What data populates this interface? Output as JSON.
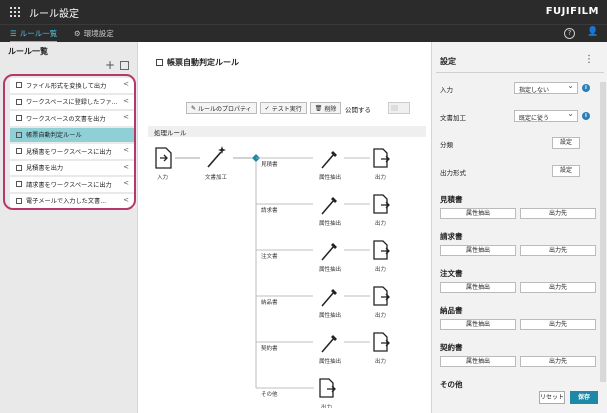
{
  "window": {
    "title": "ルール設定",
    "brand": "FUJIFILM"
  },
  "tabs": [
    {
      "label": "ルール一覧"
    },
    {
      "label": "環境設定"
    }
  ],
  "sidebar": {
    "title": "ルール一覧",
    "add_glyph": "+",
    "items": [
      {
        "label": "ファイル形式を変換して出力"
      },
      {
        "label": "ワークスペースに登録したファ..."
      },
      {
        "label": "ワークスペースの文書を出力"
      },
      {
        "label": "帳票自動判定ルール"
      },
      {
        "label": "見積書をワークスペースに出力"
      },
      {
        "label": "見積書を出力"
      },
      {
        "label": "請求書をワークスペースに出力"
      },
      {
        "label": "電子メールで入力した文書..."
      }
    ],
    "selected_index": 3
  },
  "main": {
    "rule_title": "帳票自動判定ルール",
    "toolbar": {
      "properties": "ルールのプロパティ",
      "test": "テスト実行",
      "delete": "削除",
      "publish": "公開する"
    },
    "section": "処理ルール",
    "flow": {
      "input": "入力",
      "doc_process": "文書加工",
      "branches": [
        "見積書",
        "請求書",
        "注文書",
        "納品書",
        "契約書",
        "その他"
      ],
      "extract": "属性抽出",
      "output": "出力"
    }
  },
  "settings": {
    "title": "設定",
    "input_label": "入力",
    "input_value": "指定しない",
    "doc_label": "文書加工",
    "doc_value": "既定に従う",
    "classify_label": "分類",
    "format_label": "出力形式",
    "set_button": "設定",
    "groups": [
      "見積書",
      "請求書",
      "注文書",
      "納品書",
      "契約書",
      "その他"
    ],
    "extract_button": "属性抽出",
    "dest_button": "出力先",
    "reset": "リセット",
    "save": "保存"
  }
}
